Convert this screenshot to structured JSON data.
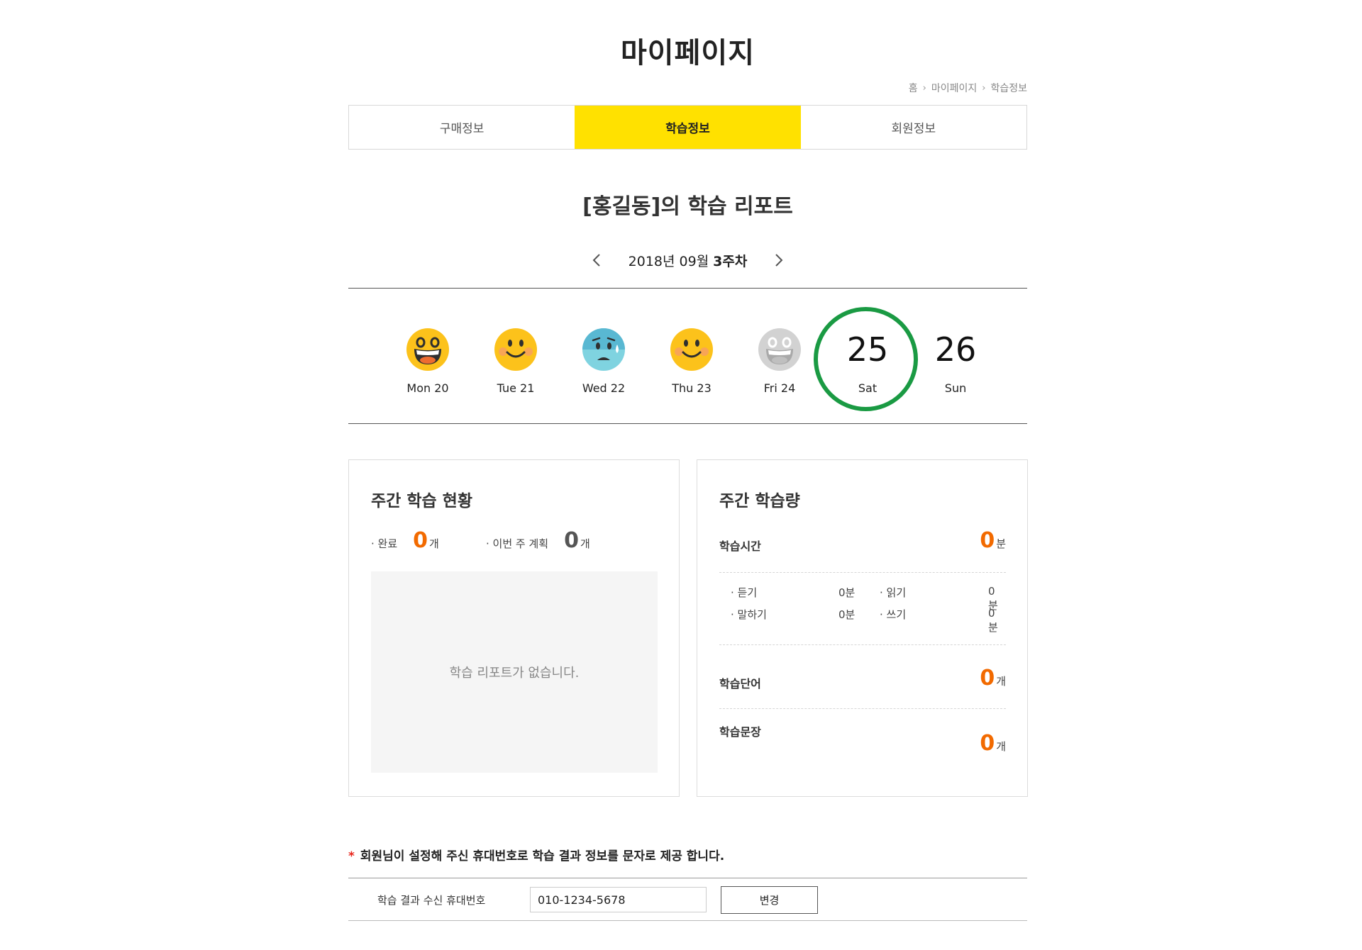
{
  "page_title": "마이페이지",
  "breadcrumb": [
    "홈",
    "마이페이지",
    "학습정보"
  ],
  "tabs": [
    {
      "label": "구매정보",
      "active": false
    },
    {
      "label": "학습정보",
      "active": true
    },
    {
      "label": "회원정보",
      "active": false
    }
  ],
  "report": {
    "title": "[홍길동]의 학습 리포트",
    "week_year_month": "2018년 09월",
    "week_number": "3주차"
  },
  "days": [
    {
      "label": "Mon 20",
      "icon": "laughing-face-icon"
    },
    {
      "label": "Tue 21",
      "icon": "smiling-face-icon"
    },
    {
      "label": "Wed 22",
      "icon": "sad-sweat-face-icon"
    },
    {
      "label": "Thu 23",
      "icon": "smiling-face-icon"
    },
    {
      "label": "Fri 24",
      "icon": "gray-laughing-face-icon"
    },
    {
      "num": "25",
      "label": "Sat",
      "selected": true
    },
    {
      "num": "26",
      "label": "Sun"
    }
  ],
  "weekly_status": {
    "title": "주간 학습 현황",
    "completed_label": "· 완료",
    "completed_value": "0",
    "completed_unit": "개",
    "plan_label": "· 이번 주 계획",
    "plan_value": "0",
    "plan_unit": "개",
    "empty_message": "학습 리포트가 없습니다."
  },
  "weekly_volume": {
    "title": "주간 학습량",
    "time_label": "학습시간",
    "time_value": "0",
    "time_unit": "분",
    "skills": [
      {
        "label": "· 듣기",
        "value": "0분"
      },
      {
        "label": "· 읽기",
        "value": "0분"
      },
      {
        "label": "· 말하기",
        "value": "0분"
      },
      {
        "label": "· 쓰기",
        "value": "0분"
      }
    ],
    "words_label": "학습단어",
    "words_value": "0",
    "words_unit": "개",
    "sentences_label": "학습문장",
    "sentences_value": "0",
    "sentences_unit": "개"
  },
  "notice": {
    "star": "*",
    "text": "회원님이 설정해 주신 휴대번호로 학습 결과 정보를 문자로 제공 합니다."
  },
  "phone": {
    "label": "학습 결과 수신 휴대번호",
    "value": "010-1234-5678",
    "button": "변경"
  },
  "colors": {
    "accent_yellow": "#ffe100",
    "highlight_orange": "#f26a00",
    "selected_ring": "#1a9a43",
    "notice_star": "#e8251b"
  }
}
